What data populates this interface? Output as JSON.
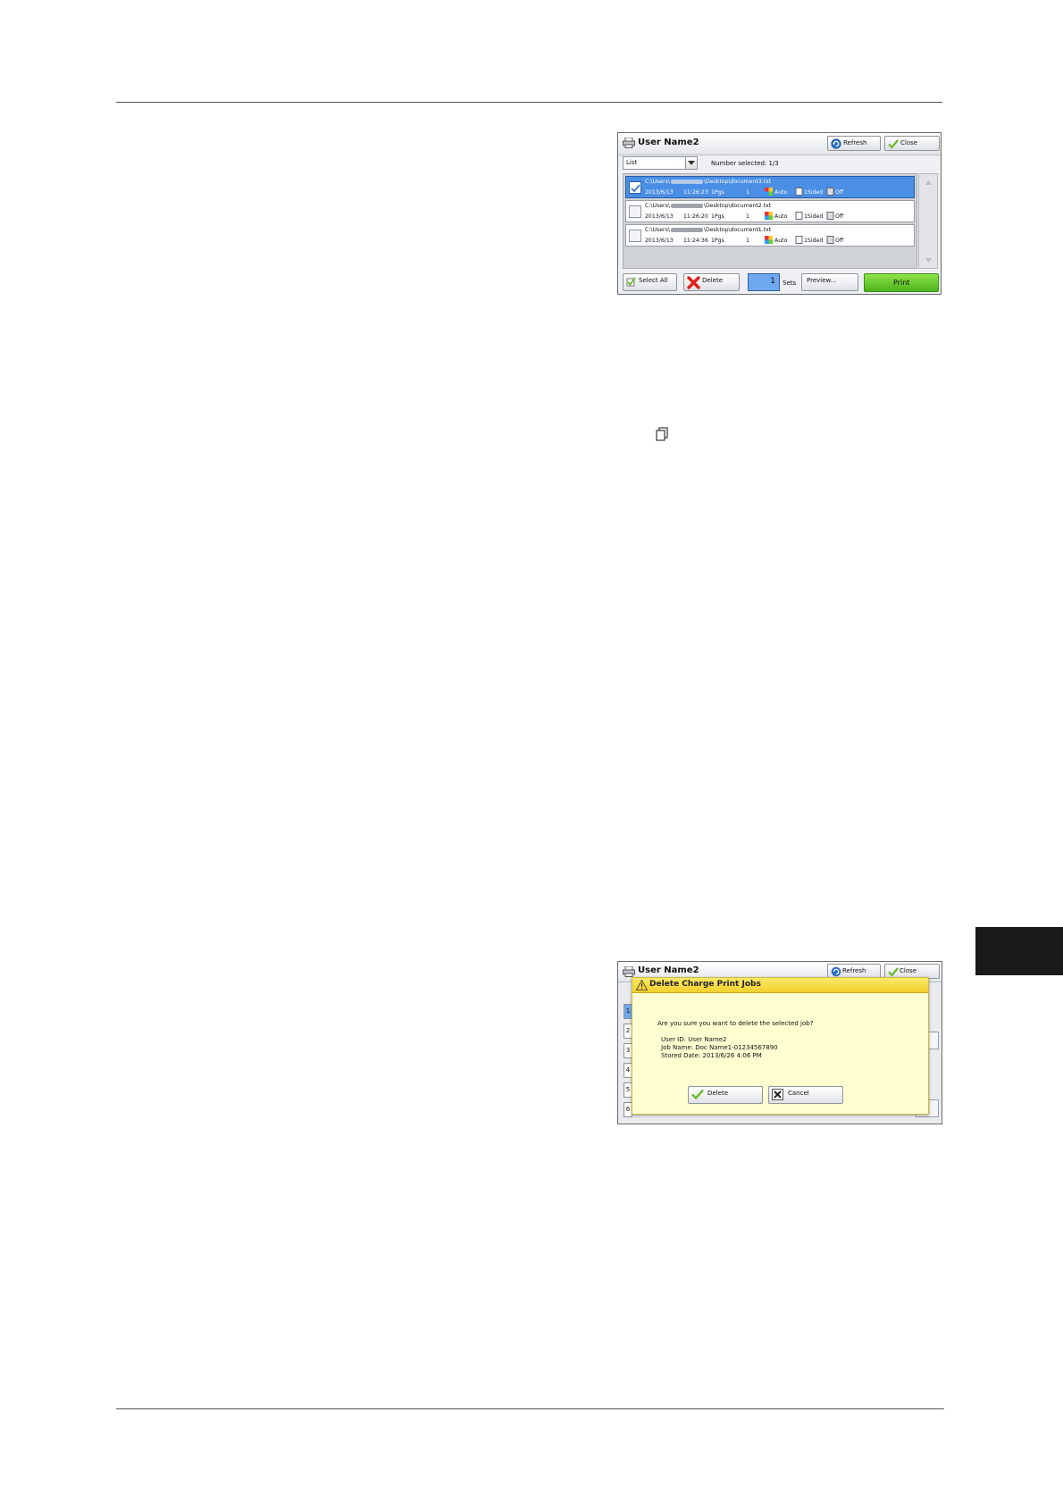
{
  "screen1": {
    "title": "User Name2",
    "refresh_label": "Refresh",
    "close_label": "Close",
    "dropdown_value": "List",
    "number_selected": "Number selected: 1/3",
    "jobs": [
      {
        "path_start": "C:\\Users\\",
        "path_end": "\\Desktop\\document3.txt",
        "date": "2013/6/13",
        "time": "11:26:23",
        "pages": "1Pgs",
        "qty": "1",
        "color": "Auto",
        "sides": "1Sided",
        "staple": "Off",
        "selected": true
      },
      {
        "path_start": "C:\\Users\\",
        "path_end": "\\Desktop\\document2.txt",
        "date": "2013/6/13",
        "time": "11:26:20",
        "pages": "1Pgs",
        "qty": "1",
        "color": "Auto",
        "sides": "1Sided",
        "staple": "Off",
        "selected": false
      },
      {
        "path_start": "C:\\Users\\",
        "path_end": "\\Desktop\\document1.txt",
        "date": "2013/6/13",
        "time": "11:24:36",
        "pages": "1Pgs",
        "qty": "1",
        "color": "Auto",
        "sides": "1Sided",
        "staple": "Off",
        "selected": false
      }
    ],
    "select_all_label": "Select All",
    "delete_label": "Delete",
    "sets_value": "1",
    "sets_label": "Sets",
    "preview_label": "Preview...",
    "print_label": "Print"
  },
  "screen2": {
    "bg_title": "User Name2",
    "bg_refresh_label": "Refresh",
    "bg_close_label": "Close",
    "bg_row_numbers": [
      "1",
      "2",
      "3",
      "4",
      "5",
      "6"
    ],
    "bg_colon": ":",
    "dialog": {
      "title": "Delete Charge Print Jobs",
      "question": "Are you sure you want to delete the selected job?",
      "user_id": "User ID: User Name2",
      "job_name": "Job Name: Doc Name1-01234567890",
      "stored_date": "Stored Date: 2013/6/26 4:06 PM",
      "delete_label": "Delete",
      "cancel_label": "Cancel"
    }
  },
  "colors": {
    "selected_row": "#4a8ee6",
    "print_button": "#5cc022",
    "dialog_header": "#f5d737",
    "dialog_body": "#ffffd2",
    "side_tab": "#1a1a1a"
  }
}
